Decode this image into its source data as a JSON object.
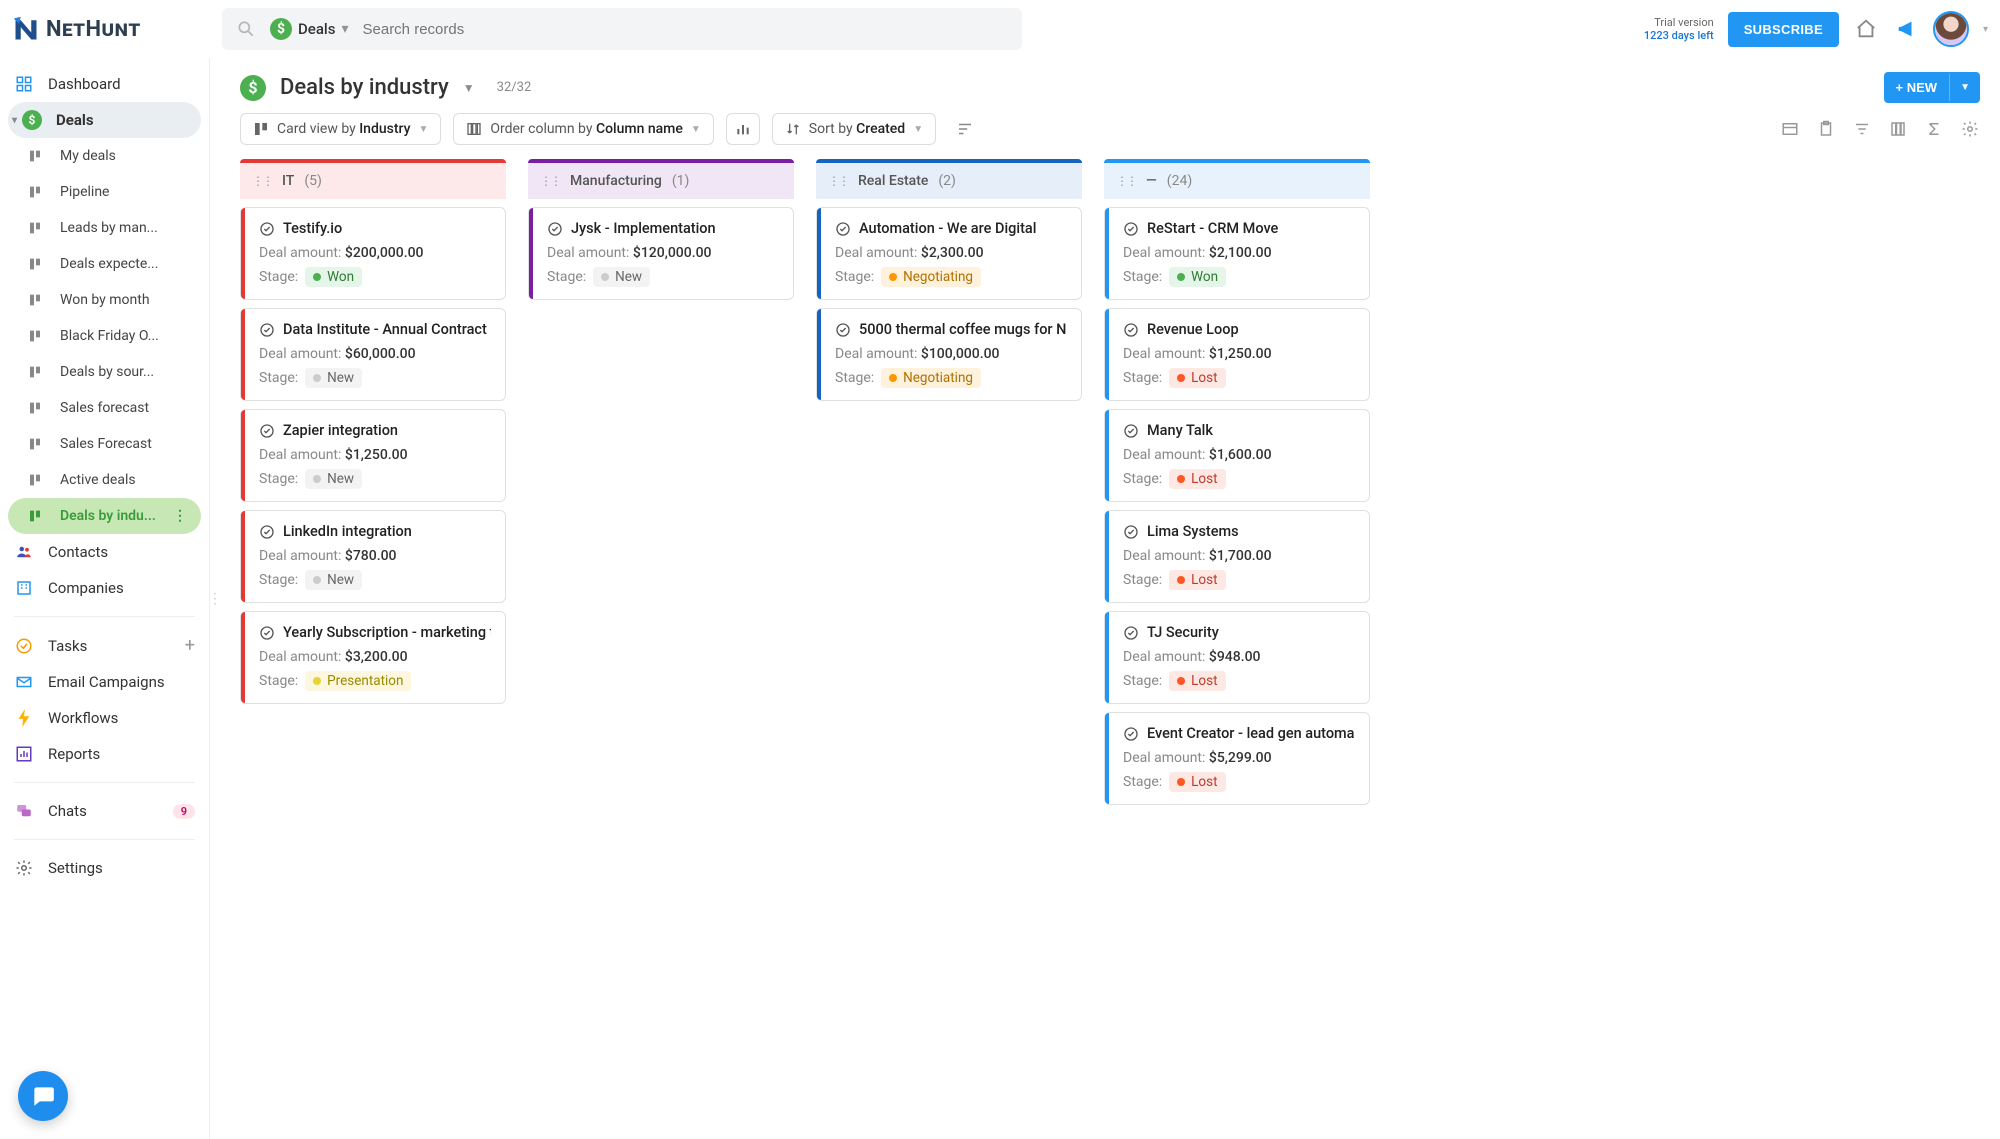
{
  "header": {
    "logo_text": "NetHunt",
    "search_scope": "Deals",
    "search_placeholder": "Search records",
    "trial_line1": "Trial version",
    "trial_line2": "1223 days left",
    "subscribe": "SUBSCRIBE"
  },
  "sidebar": {
    "dashboard": "Dashboard",
    "deals": "Deals",
    "deals_children": [
      "My deals",
      "Pipeline",
      "Leads by man...",
      "Deals expecte...",
      "Won by month",
      "Black Friday O...",
      "Deals by sour...",
      "Sales forecast",
      "Sales Forecast",
      "Active deals",
      "Deals by indu..."
    ],
    "contacts": "Contacts",
    "companies": "Companies",
    "tasks": "Tasks",
    "email_campaigns": "Email Campaigns",
    "workflows": "Workflows",
    "reports": "Reports",
    "chats": "Chats",
    "chats_badge": "9",
    "settings": "Settings"
  },
  "page": {
    "title": "Deals by industry",
    "count": "32/32",
    "new_button": "+ NEW"
  },
  "toolbar": {
    "card_view_prefix": "Card view by ",
    "card_view_value": "Industry",
    "order_prefix": "Order column by ",
    "order_value": "Column name",
    "sort_prefix": "Sort by ",
    "sort_value": "Created"
  },
  "columns": [
    {
      "key": "it",
      "name": "IT",
      "count": "(5)",
      "header_class": "col-it",
      "accent": "acc-red",
      "cards": [
        {
          "title": "Testify.io",
          "amount": "$200,000.00",
          "stage": "Won",
          "stage_class": "stage-won"
        },
        {
          "title": "Data Institute - Annual Contract",
          "amount": "$60,000.00",
          "stage": "New",
          "stage_class": "stage-new"
        },
        {
          "title": "Zapier integration",
          "amount": "$1,250.00",
          "stage": "New",
          "stage_class": "stage-new"
        },
        {
          "title": "LinkedIn integration",
          "amount": "$780.00",
          "stage": "New",
          "stage_class": "stage-new"
        },
        {
          "title": "Yearly Subscription - marketing t...",
          "amount": "$3,200.00",
          "stage": "Presentation",
          "stage_class": "stage-pres"
        }
      ]
    },
    {
      "key": "mfg",
      "name": "Manufacturing",
      "count": "(1)",
      "header_class": "col-mfg",
      "accent": "acc-purple",
      "cards": [
        {
          "title": "Jysk - Implementation",
          "amount": "$120,000.00",
          "stage": "New",
          "stage_class": "stage-new"
        }
      ]
    },
    {
      "key": "re",
      "name": "Real Estate",
      "count": "(2)",
      "header_class": "col-re",
      "accent": "acc-navy",
      "cards": [
        {
          "title": "Automation - We are Digital",
          "amount": "$2,300.00",
          "stage": "Negotiating",
          "stage_class": "stage-neg"
        },
        {
          "title": "5000 thermal coffee mugs for N...",
          "amount": "$100,000.00",
          "stage": "Negotiating",
          "stage_class": "stage-neg"
        }
      ]
    },
    {
      "key": "none",
      "name": "—",
      "count": "(24)",
      "header_class": "col-none",
      "accent": "acc-blue",
      "cards": [
        {
          "title": "ReStart - CRM Move",
          "amount": "$2,100.00",
          "stage": "Won",
          "stage_class": "stage-won"
        },
        {
          "title": "Revenue Loop",
          "amount": "$1,250.00",
          "stage": "Lost",
          "stage_class": "stage-lost"
        },
        {
          "title": "Many Talk",
          "amount": "$1,600.00",
          "stage": "Lost",
          "stage_class": "stage-lost"
        },
        {
          "title": "Lima Systems",
          "amount": "$1,700.00",
          "stage": "Lost",
          "stage_class": "stage-lost"
        },
        {
          "title": "TJ Security",
          "amount": "$948.00",
          "stage": "Lost",
          "stage_class": "stage-lost"
        },
        {
          "title": "Event Creator - lead gen automa...",
          "amount": "$5,299.00",
          "stage": "Lost",
          "stage_class": "stage-lost"
        }
      ]
    }
  ],
  "labels": {
    "deal_amount": "Deal amount: ",
    "stage": "Stage:"
  }
}
